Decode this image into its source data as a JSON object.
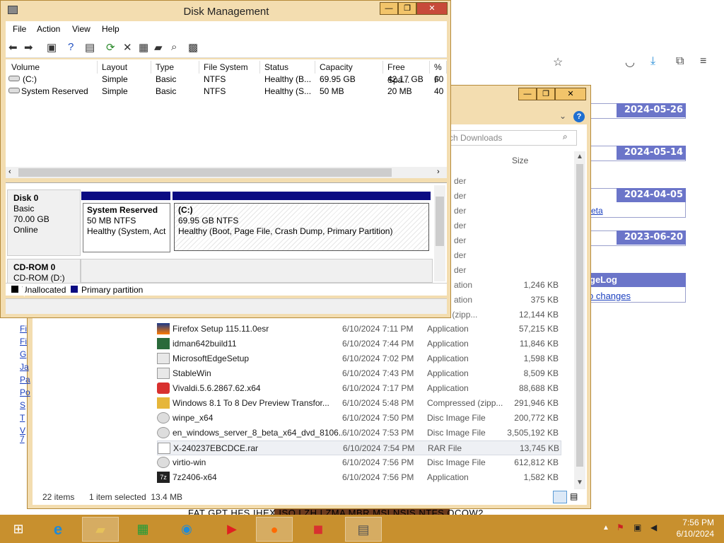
{
  "browser": {
    "dates": [
      "2024-05-26",
      "2024-05-14",
      "2024-04-05",
      "2023-06-20"
    ],
    "link_beta": "eta",
    "page_log_title": "geLog",
    "link_changes": "o changes"
  },
  "explorer": {
    "search_placeholder": "rch Downloads",
    "col_size": "Size",
    "ghost_rows": [
      {
        "type": "der",
        "size": ""
      },
      {
        "type": "der",
        "size": ""
      },
      {
        "type": "der",
        "size": ""
      },
      {
        "type": "der",
        "size": ""
      },
      {
        "type": "der",
        "size": ""
      },
      {
        "type": "der",
        "size": ""
      },
      {
        "type": "der",
        "size": ""
      },
      {
        "type": "ation",
        "size": "1,246 KB"
      },
      {
        "type": "ation",
        "size": "375 KB"
      },
      {
        "type": "essed (zipp...",
        "size": "12,144 KB"
      }
    ],
    "files": [
      {
        "name": "Firefox Setup 115.11.0esr",
        "date": "6/10/2024 7:11 PM",
        "type": "Application",
        "size": "57,215 KB"
      },
      {
        "name": "idman642build11",
        "date": "6/10/2024 7:44 PM",
        "type": "Application",
        "size": "11,846 KB"
      },
      {
        "name": "MicrosoftEdgeSetup",
        "date": "6/10/2024 7:02 PM",
        "type": "Application",
        "size": "1,598 KB"
      },
      {
        "name": "StableWin",
        "date": "6/10/2024 7:43 PM",
        "type": "Application",
        "size": "8,509 KB"
      },
      {
        "name": "Vivaldi.5.6.2867.62.x64",
        "date": "6/10/2024 7:17 PM",
        "type": "Application",
        "size": "88,688 KB"
      },
      {
        "name": "Windows 8.1 To 8 Dev Preview Transfor...",
        "date": "6/10/2024 5:48 PM",
        "type": "Compressed (zipp...",
        "size": "291,946 KB"
      },
      {
        "name": "winpe_x64",
        "date": "6/10/2024 7:50 PM",
        "type": "Disc Image File",
        "size": "200,772 KB"
      },
      {
        "name": "en_windows_server_8_beta_x64_dvd_8106...",
        "date": "6/10/2024 7:53 PM",
        "type": "Disc Image File",
        "size": "3,505,192 KB"
      },
      {
        "name": "X-240237EBCDCE.rar",
        "date": "6/10/2024 7:54 PM",
        "type": "RAR File",
        "size": "13,745 KB"
      },
      {
        "name": "virtio-win",
        "date": "6/10/2024 7:56 PM",
        "type": "Disc Image File",
        "size": "612,812 KB"
      },
      {
        "name": "7z2406-x64",
        "date": "6/10/2024 7:56 PM",
        "type": "Application",
        "size": "1,582 KB"
      }
    ],
    "items_count": "22 items",
    "selected": "1 item selected  13.4 MB",
    "side_links": [
      "Fi",
      "Fi",
      "G",
      "Ja",
      "Pa",
      "Po",
      "S",
      "T",
      "V",
      "7"
    ]
  },
  "disk_mgmt": {
    "title": "Disk Management",
    "menu": [
      "File",
      "Action",
      "View",
      "Help"
    ],
    "columns": [
      "Volume",
      "Layout",
      "Type",
      "File System",
      "Status",
      "Capacity",
      "Free Spa...",
      "% F"
    ],
    "volumes": [
      {
        "volume": "(C:)",
        "layout": "Simple",
        "type": "Basic",
        "fs": "NTFS",
        "status": "Healthy (B...",
        "capacity": "69.95 GB",
        "free": "42.17 GB",
        "pct": "60"
      },
      {
        "volume": "System Reserved",
        "layout": "Simple",
        "type": "Basic",
        "fs": "NTFS",
        "status": "Healthy (S...",
        "capacity": "50 MB",
        "free": "20 MB",
        "pct": "40"
      }
    ],
    "disk0": {
      "name": "Disk 0",
      "type": "Basic",
      "size": "70.00 GB",
      "state": "Online"
    },
    "part_sys": {
      "name": "System Reserved",
      "size": "50 MB NTFS",
      "status": "Healthy (System, Acti"
    },
    "part_c": {
      "name": "(C:)",
      "size": "69.95 GB NTFS",
      "status": "Healthy (Boot, Page File, Crash Dump, Primary Partition)"
    },
    "cdrom": {
      "name": "CD-ROM 0",
      "drive": "CD-ROM (D:)"
    },
    "legend": {
      "unallocated": "Unallocated",
      "primary": "Primary partition"
    }
  },
  "underlay_text": "FAT  GPT  HFS  IHEX  ISO  LZH  LZMA  MBR  MSI  NSIS  NTFS  QCOW2",
  "taskbar": {
    "time": "7:56 PM",
    "date": "6/10/2024"
  },
  "colors": {
    "accent": "#c8902e",
    "partition": "#0b0b82",
    "datebar": "#6b75c9",
    "link": "#1a3fbf"
  }
}
